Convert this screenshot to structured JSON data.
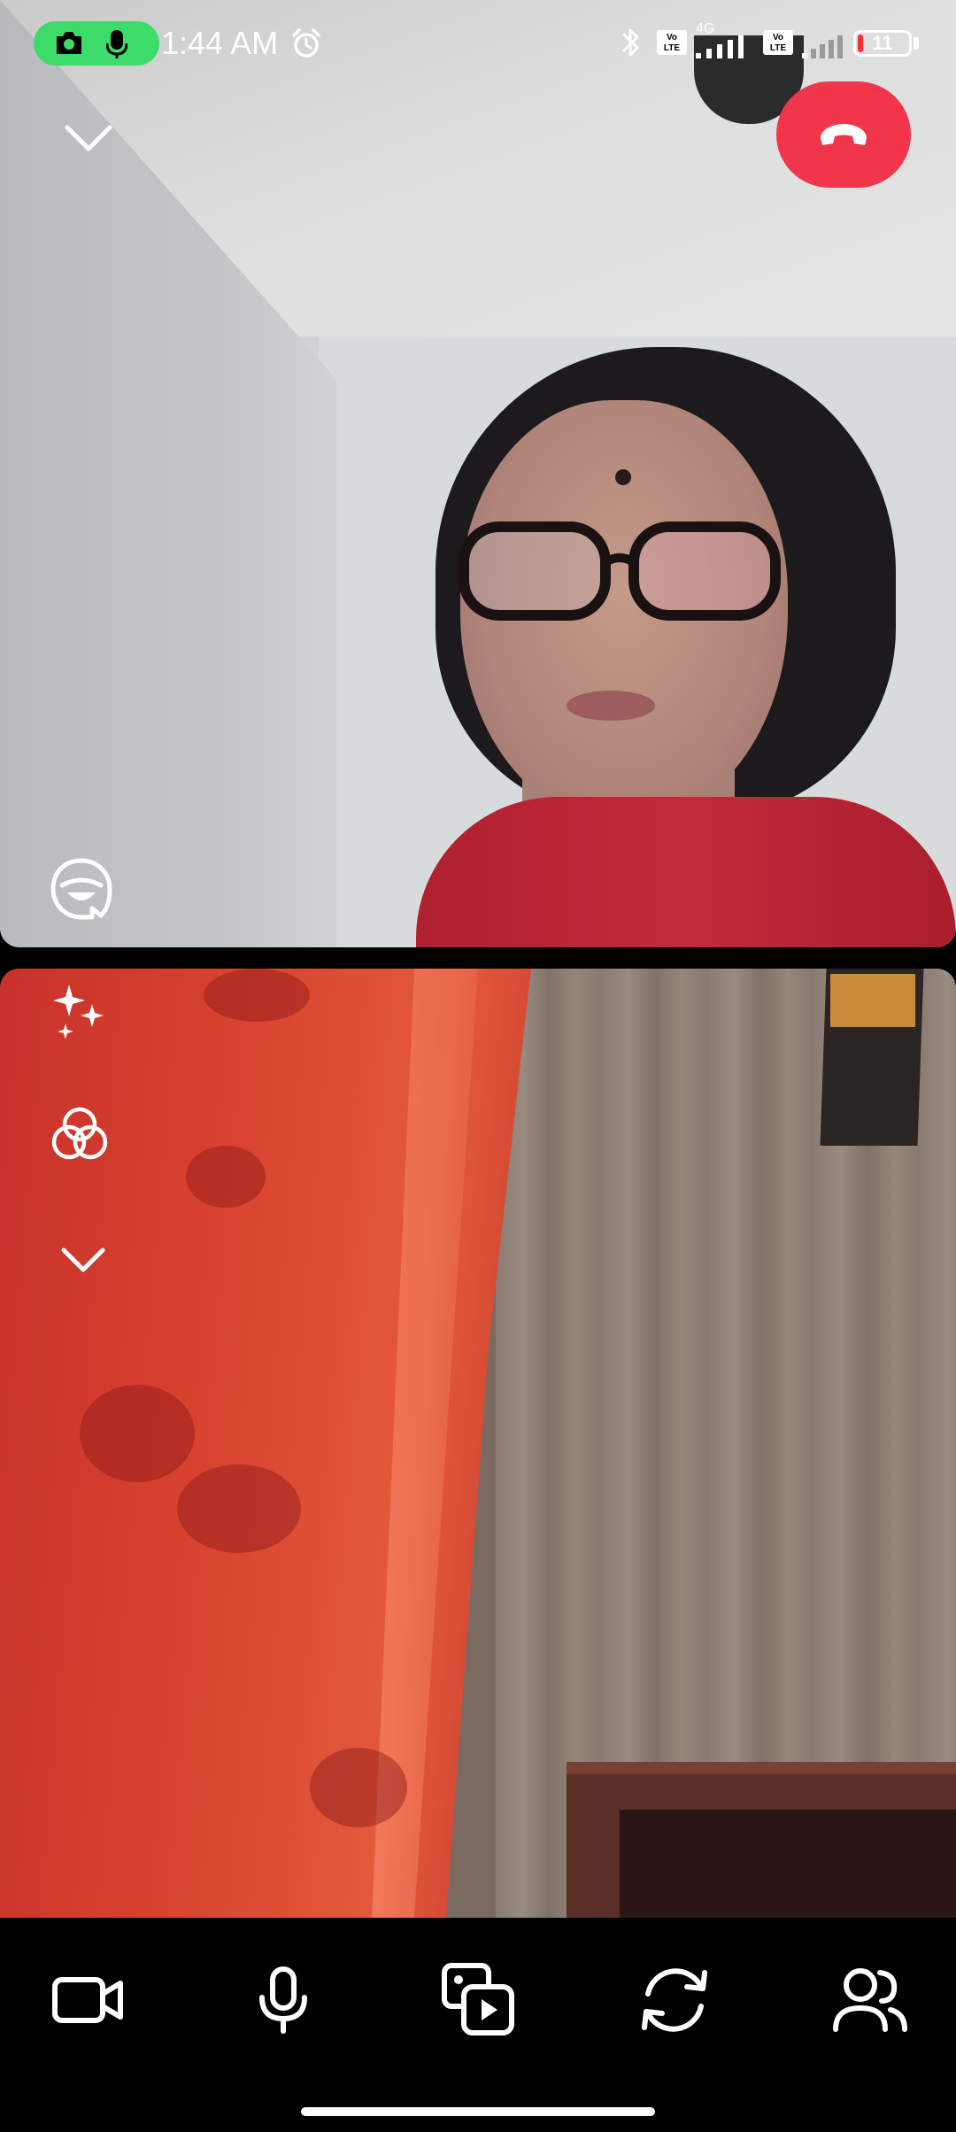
{
  "status_bar": {
    "time": "1:44 AM",
    "network_label": "4G",
    "volte_label_1": "Vo LTE",
    "volte_label_2": "Vo LTE",
    "battery_level": "11",
    "battery_fraction": 0.11,
    "battery_color": "#ff3030",
    "recording_indicator_color": "#3ddc6a"
  },
  "call": {
    "end_call_color": "#f1354a"
  },
  "controls": {
    "icons": [
      "video-camera-icon",
      "microphone-icon",
      "media-share-icon",
      "flip-camera-icon",
      "participants-icon"
    ]
  }
}
